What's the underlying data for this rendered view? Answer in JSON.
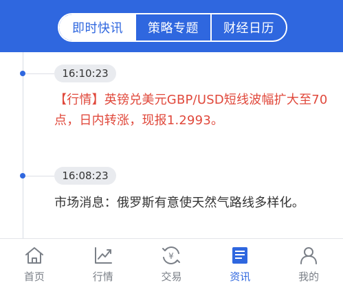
{
  "header": {
    "tabs": [
      {
        "label": "即时快讯",
        "active": true
      },
      {
        "label": "策略专题",
        "active": false
      },
      {
        "label": "财经日历",
        "active": false
      }
    ]
  },
  "feed": {
    "items": [
      {
        "time": "16:10:23",
        "text": "【行情】英镑兑美元GBP/USD短线波幅扩大至70点，日内转涨，现报1.2993。",
        "highlight": true
      },
      {
        "time": "16:08:23",
        "text": "市场消息：俄罗斯有意使天然气路线多样化。",
        "highlight": false
      }
    ]
  },
  "bottom_nav": {
    "items": [
      {
        "label": "首页",
        "icon": "home-icon",
        "active": false
      },
      {
        "label": "行情",
        "icon": "chart-icon",
        "active": false
      },
      {
        "label": "交易",
        "icon": "exchange-icon",
        "active": false
      },
      {
        "label": "资讯",
        "icon": "news-icon",
        "active": true
      },
      {
        "label": "我的",
        "icon": "user-icon",
        "active": false
      }
    ]
  },
  "colors": {
    "brand_blue": "#2f67df",
    "highlight_red": "#e0483b",
    "text_dark": "#333333",
    "nav_gray": "#7a7f87"
  }
}
